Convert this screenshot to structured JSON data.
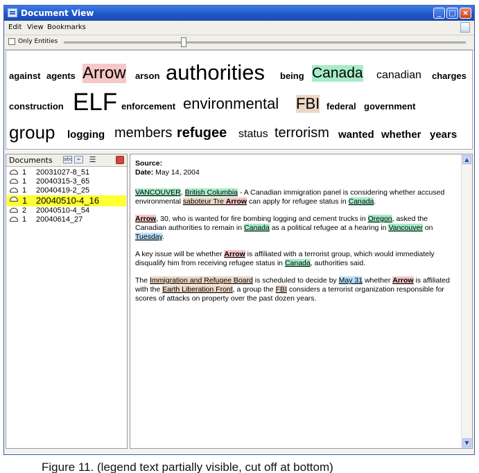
{
  "window": {
    "title": "Document View",
    "minimize": "_",
    "maximize": "□",
    "close": "×"
  },
  "menu": [
    "Edit",
    "View",
    "Bookmarks"
  ],
  "toolbar": {
    "only_entities_label": "Only Entities",
    "only_entities_checked": false,
    "slider_level_percent": 30
  },
  "tag_cloud": {
    "rows": [
      [
        "against",
        "agents",
        "Arrow",
        "arson",
        "authorities",
        "being",
        "Canada",
        "canadian",
        "charges"
      ],
      [
        "construction",
        "ELF",
        "enforcement",
        "environmental",
        "FBI",
        "federal",
        "government"
      ],
      [
        "group",
        "logging",
        "members",
        "refugee",
        "status",
        "terrorism",
        "wanted",
        "whether",
        "years"
      ]
    ]
  },
  "documents": {
    "header": "Documents",
    "list": [
      {
        "count": "1",
        "name": "20031027-8_51",
        "selected": false
      },
      {
        "count": "1",
        "name": "20040315-3_65",
        "selected": false
      },
      {
        "count": "1",
        "name": "20040419-2_25",
        "selected": false
      },
      {
        "count": "1",
        "name": "20040510-4_16",
        "selected": true
      },
      {
        "count": "2",
        "name": "20040510-4_54",
        "selected": false
      },
      {
        "count": "1",
        "name": "20040614_27",
        "selected": false
      }
    ]
  },
  "document": {
    "source_label": "Source:",
    "date_label": "Date:",
    "date_value": " May 14, 2004",
    "paragraphs": [
      [
        {
          "t": "VANCOUVER",
          "e": "loc"
        },
        {
          "t": ", "
        },
        {
          "t": "British Columbia",
          "e": "loc"
        },
        {
          "t": " - A Canadian immigration panel is considering whether accused environmental "
        },
        {
          "t": "saboteur Tre ",
          "e": "org"
        },
        {
          "t": "Arrow",
          "e": "person"
        },
        {
          "t": " can apply for refugee status in "
        },
        {
          "t": "Canada",
          "e": "loc"
        },
        {
          "t": "."
        }
      ],
      [
        {
          "t": "Arrow",
          "e": "person"
        },
        {
          "t": ", 30, who is wanted for fire bombing logging and cement trucks in "
        },
        {
          "t": "Oregon",
          "e": "loc"
        },
        {
          "t": ", asked the Canadian authorities to remain in "
        },
        {
          "t": "Canada",
          "e": "loc"
        },
        {
          "t": " as a political refugee at a hearing in "
        },
        {
          "t": "Vancouver",
          "e": "loc"
        },
        {
          "t": " on "
        },
        {
          "t": "Tuesday",
          "e": "date"
        },
        {
          "t": "."
        }
      ],
      [
        {
          "t": "A key issue will be whether "
        },
        {
          "t": "Arrow",
          "e": "person"
        },
        {
          "t": " is affiliated with a terrorist group, which would immediately disqualify him from receiving refugee status in "
        },
        {
          "t": "Canada",
          "e": "loc"
        },
        {
          "t": ", authorities said."
        }
      ],
      [
        {
          "t": "The "
        },
        {
          "t": "Immigration and Refugee Board",
          "e": "org"
        },
        {
          "t": " is scheduled to decide by "
        },
        {
          "t": "May 31",
          "e": "date"
        },
        {
          "t": " whether "
        },
        {
          "t": "Arrow",
          "e": "person"
        },
        {
          "t": " is affiliated with the "
        },
        {
          "t": "Earth Liberation Front",
          "e": "org"
        },
        {
          "t": ", a group the "
        },
        {
          "t": "FBI",
          "e": "org"
        },
        {
          "t": " considers a terrorist organization responsible for scores of attacks on property over the past dozen years."
        }
      ]
    ]
  },
  "caption": "Figure 11. (legend text partially visible, cut off at bottom)"
}
